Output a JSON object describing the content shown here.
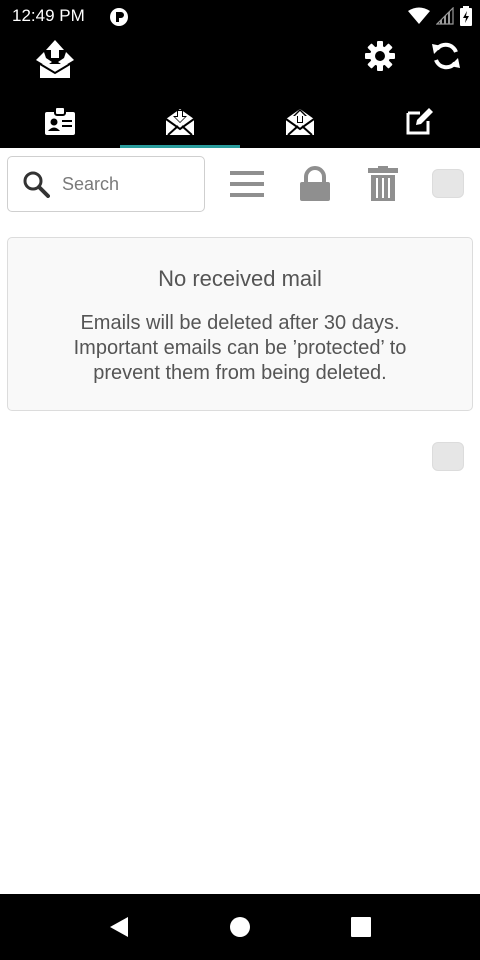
{
  "status_bar": {
    "time": "12:49 PM",
    "icons": [
      "app-notification-icon",
      "wifi-icon",
      "signal-icon",
      "battery-icon"
    ]
  },
  "app_bar": {
    "logo_icon": "recycle-mail-logo-icon",
    "settings_icon": "gear-icon",
    "refresh_icon": "refresh-icon"
  },
  "tabs": [
    {
      "name": "tab-address",
      "icon": "id-card-icon",
      "active": false
    },
    {
      "name": "tab-inbox",
      "icon": "envelope-download-icon",
      "active": true
    },
    {
      "name": "tab-sent",
      "icon": "envelope-upload-icon",
      "active": false
    },
    {
      "name": "tab-compose",
      "icon": "edit-icon",
      "active": false
    }
  ],
  "toolbar": {
    "search_placeholder": "Search",
    "search_value": "",
    "icons": [
      "menu-icon",
      "lock-icon",
      "trash-icon"
    ]
  },
  "empty_state": {
    "title": "No received mail",
    "line1": "Emails will be deleted after 30 days.",
    "line2": "Important emails can be ’protected’ to",
    "line3": "prevent them from being deleted."
  },
  "colors": {
    "accent": "#2a9d9d",
    "bar_bg": "#000000",
    "icon_gray": "#8f8f8f"
  },
  "nav_bar": {
    "icons": [
      "back-icon",
      "home-icon",
      "recents-icon"
    ]
  }
}
